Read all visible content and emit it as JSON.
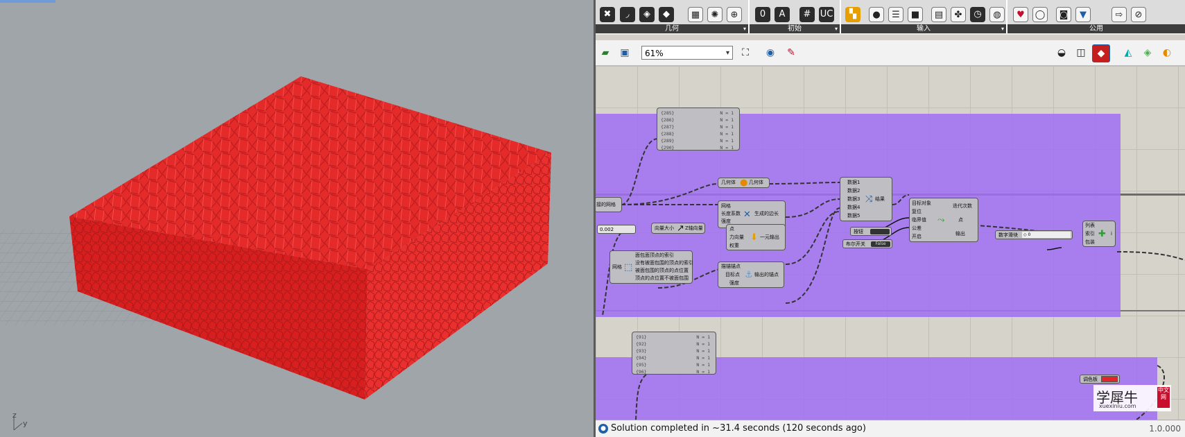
{
  "viewport": {
    "axis_z": "z",
    "axis_y": "y",
    "object_color": "#e52a2a"
  },
  "ribbon": {
    "panels": [
      {
        "label": "几何"
      },
      {
        "label": "初始"
      },
      {
        "label": "输入"
      },
      {
        "label": "公用"
      }
    ]
  },
  "toolbar": {
    "zoom_value": "61%"
  },
  "canvas": {
    "group_color": "#a06ef5",
    "panel_top": {
      "rows": [
        {
          "idx": "{285}",
          "n": "N = 1"
        },
        {
          "idx": "{286}",
          "n": "N = 1"
        },
        {
          "idx": "{287}",
          "n": "N = 1"
        },
        {
          "idx": "{288}",
          "n": "N = 1"
        },
        {
          "idx": "{289}",
          "n": "N = 1"
        },
        {
          "idx": "{290}",
          "n": "N = 1"
        }
      ]
    },
    "panel_bottom": {
      "rows": [
        {
          "idx": "{91}",
          "n": "N = 1"
        },
        {
          "idx": "{92}",
          "n": "N = 1"
        },
        {
          "idx": "{93}",
          "n": "N = 1"
        },
        {
          "idx": "{94}",
          "n": "N = 1"
        },
        {
          "idx": "{95}",
          "n": "N = 1"
        },
        {
          "idx": "{96}",
          "n": "N = 1"
        }
      ]
    },
    "geometry_param": {
      "in": "几何体",
      "out": "几何体"
    },
    "mesh_edges": {
      "in1": "网格",
      "in2": "长度系数",
      "in3": "强度",
      "out": "生成的边长"
    },
    "merge": {
      "in1": "数据1",
      "in2": "数据2",
      "in3": "数据3",
      "in4": "数据4",
      "in5": "数据5",
      "out": "结果"
    },
    "solver": {
      "in1": "目标对象",
      "in2": "复位",
      "in3": "临界值",
      "in4": "公差",
      "in5": "开启",
      "out1": "迭代次数",
      "out2": "点",
      "out3": "输出"
    },
    "button": {
      "label": "按钮"
    },
    "toggle": {
      "label": "布尔开关",
      "value": "False"
    },
    "slider_left": {
      "value": "0.002"
    },
    "vector_z": {
      "in": "向量大小",
      "out": "Z轴向量"
    },
    "load": {
      "in1": "点",
      "in2": "力向量",
      "in3": "权重",
      "out": "一元输出"
    },
    "mesh_info": {
      "in": "网格",
      "out1": "面包面顶点的索引",
      "out2": "没有被面包围的顶点的索引",
      "out3": "被面包围的顶点的点位置",
      "out4": "顶点的点位置不被面包围"
    },
    "anchor": {
      "in1": "描锚锚点",
      "in2": "目标点",
      "in3": "强度",
      "out": "输出的锚点"
    },
    "slider_right": {
      "label": "数字滑块",
      "value": "◇ 0"
    },
    "list_item": {
      "in1": "列表",
      "in2": "索引",
      "in3": "包装",
      "out": "i"
    },
    "color_swatch": {
      "label": "调色板",
      "color": "#e0262b"
    },
    "truncated_left": "接的网格"
  },
  "status": {
    "text": "Solution completed in ~31.4 seconds (120 seconds ago)",
    "version": "1.0.000"
  },
  "watermark": {
    "text": "学犀牛",
    "url": "xuexiniu.com",
    "seal": "中文网"
  }
}
